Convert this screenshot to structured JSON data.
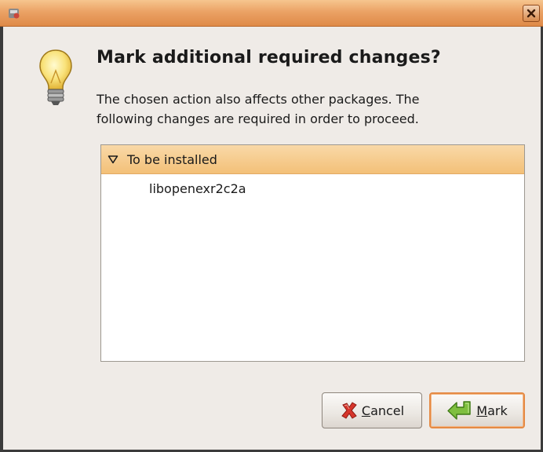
{
  "window": {
    "title": ""
  },
  "dialog": {
    "heading": "Mark additional required changes?",
    "message_line1": "The chosen action also affects other packages. The",
    "message_line2": "following changes are required in order to proceed."
  },
  "changes": {
    "group_label": "To be installed",
    "expanded": true,
    "items": [
      "libopenexr2c2a"
    ]
  },
  "buttons": {
    "cancel_mnemonic": "C",
    "cancel_rest": "ancel",
    "mark_mnemonic": "M",
    "mark_rest": "ark"
  },
  "colors": {
    "titlebar": "#e59a5c",
    "selection_row": "#f6cc90",
    "default_button_border": "#e58a44"
  },
  "icons": {
    "titlebar": "app-icon",
    "dialog": "lightbulb-icon",
    "expander": "triangle-down-icon",
    "cancel": "cancel-x-icon",
    "mark": "apply-arrow-icon",
    "close": "close-icon"
  }
}
